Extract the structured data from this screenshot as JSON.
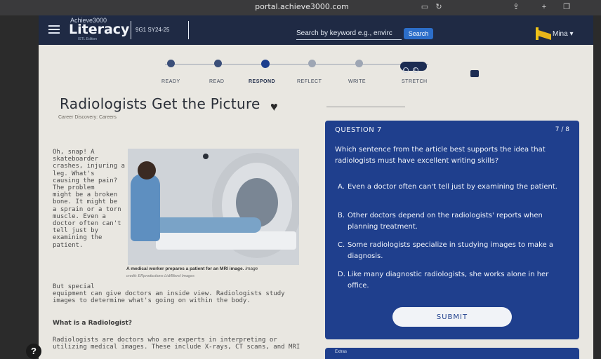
{
  "browser": {
    "url": "portal.achieve3000.com"
  },
  "header": {
    "brand_top": "Achieve3000",
    "brand": "Literacy",
    "brand_sub": "ISTL Edition",
    "class_code": "9G1 SY24-25",
    "search_placeholder": "Search by keyword e.g., envirc",
    "search_button": "Search",
    "user": "Mina"
  },
  "steps": [
    {
      "label": "READY",
      "state": "done"
    },
    {
      "label": "READ",
      "state": "done"
    },
    {
      "label": "RESPOND",
      "state": "current"
    },
    {
      "label": "REFLECT",
      "state": "todo"
    },
    {
      "label": "WRITE",
      "state": "todo"
    },
    {
      "label": "STRETCH",
      "state": "todo"
    }
  ],
  "article": {
    "title": "Radiologists Get the Picture",
    "subtitle": "Career Discovery: Careers",
    "intro": "Oh, snap! A\nskateboarder\ncrashes, injuring a\nleg. What's\ncausing the pain?\nThe problem\nmight be a broken\nbone. It might be\na sprain or a torn\nmuscle. Even a\ndoctor often can't\ntell just by\nexamining the\npatient.",
    "caption": "A medical worker prepares a patient for an MRI image.",
    "caption_tail": "Image",
    "caption_credit": "credit: ERproductions Ltd/Blend Images",
    "continued": "But special\nequipment can give doctors an inside view. Radiologists study\nimages to determine what's going on within the body.",
    "heading": "What is a Radiologist?",
    "section": "Radiologists are doctors who are experts in interpreting or\nutilizing medical images. These include X-rays, CT scans, and MRI"
  },
  "question": {
    "label": "QUESTION 7",
    "count": "7 / 8",
    "text": "Which sentence from the article best supports the idea that radiologists must have excellent writing skills?",
    "choices": [
      {
        "letter": "A.",
        "text": "Even a doctor often can't tell just by examining the patient."
      },
      {
        "letter": "B.",
        "text": "Other doctors depend on the radiologists' reports when planning treatment."
      },
      {
        "letter": "C.",
        "text": "Some radiologists specialize in studying images to make a diagnosis."
      },
      {
        "letter": "D.",
        "text": "Like many diagnostic radiologists, she works alone in her office."
      }
    ],
    "submit": "SUBMIT"
  },
  "extras": "Extras",
  "help": "?"
}
